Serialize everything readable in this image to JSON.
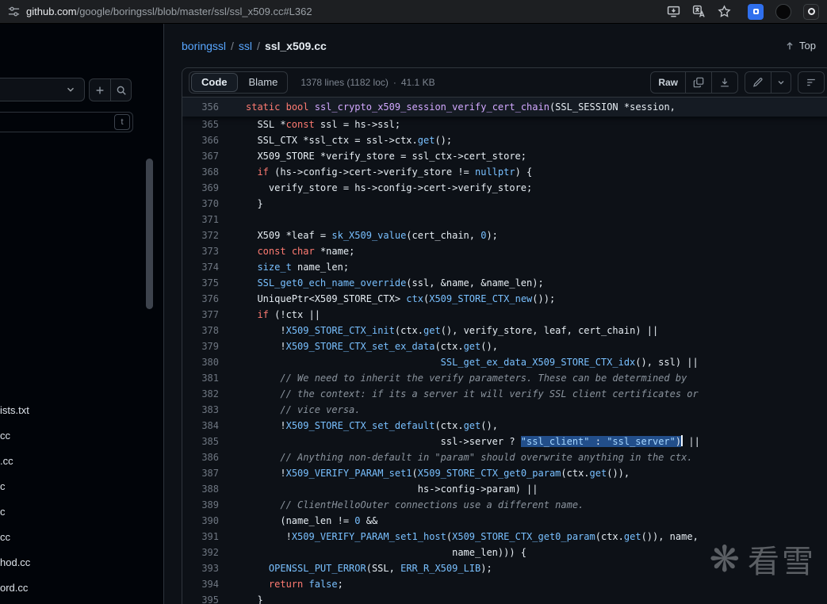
{
  "browser": {
    "url_domain": "github.com",
    "url_path": "/google/boringssl/blob/master/ssl/ssl_x509.cc#L362",
    "icons": [
      "tune-icon",
      "save-page-icon",
      "translate-icon",
      "bookmark-star-icon",
      "extension-icon",
      "profile-avatar",
      "apps-icon"
    ]
  },
  "breadcrumb": {
    "repo": "boringssl",
    "dir": "ssl",
    "file": "ssl_x509.cc",
    "separator": "/",
    "top_label": "Top"
  },
  "toolbar": {
    "code_tab": "Code",
    "blame_tab": "Blame",
    "lines_info": "1378 lines (1182 loc)",
    "dot": "·",
    "size_info": "41.1 KB",
    "raw_label": "Raw"
  },
  "sidebar": {
    "shortcut_hint": "t",
    "files": [
      "ists.txt",
      "cc",
      ".cc",
      "c",
      "c",
      "cc",
      "hod.cc",
      "ord.cc"
    ]
  },
  "watermark": {
    "logo": "❋",
    "text": "看雪"
  },
  "theme": {
    "background": "#0d1117",
    "sidebar_background": "#010409",
    "border": "#30363d",
    "link_blue": "#58a6ff",
    "keyword_red": "#ff7b72",
    "call_blue": "#79c0ff",
    "string_blue": "#a5d6ff",
    "function_purple": "#d2a8ff",
    "comment_gray": "#8b949e",
    "line_number_gray": "#6e7681",
    "selection_blue": "#1f6feb"
  },
  "code": {
    "lines": [
      {
        "n": "356",
        "sticky": true,
        "ind": 0,
        "segs": [
          {
            "t": "static",
            "c": "k"
          },
          {
            "t": " "
          },
          {
            "t": "bool",
            "c": "k"
          },
          {
            "t": " "
          },
          {
            "t": "ssl_crypto_x509_session_verify_cert_chain",
            "c": "fn"
          },
          {
            "t": "(SSL_SESSION *session,"
          }
        ]
      },
      {
        "n": "365",
        "ind": 2,
        "segs": [
          {
            "t": "SSL *"
          },
          {
            "t": "const",
            "c": "k"
          },
          {
            "t": " ssl = hs->ssl;"
          }
        ]
      },
      {
        "n": "366",
        "ind": 2,
        "segs": [
          {
            "t": "SSL_CTX *ssl_ctx = ssl->ctx."
          },
          {
            "t": "get",
            "c": "c"
          },
          {
            "t": "();"
          }
        ]
      },
      {
        "n": "367",
        "ind": 2,
        "segs": [
          {
            "t": "X509_STORE *verify_store = ssl_ctx->cert_store;"
          }
        ]
      },
      {
        "n": "368",
        "ind": 2,
        "segs": [
          {
            "t": "if",
            "c": "k"
          },
          {
            "t": " (hs->config->cert->verify_store != "
          },
          {
            "t": "nullptr",
            "c": "c"
          },
          {
            "t": ") {"
          }
        ]
      },
      {
        "n": "369",
        "ind": 4,
        "segs": [
          {
            "t": "verify_store = hs->config->cert->verify_store;"
          }
        ]
      },
      {
        "n": "370",
        "ind": 2,
        "segs": [
          {
            "t": "}"
          }
        ]
      },
      {
        "n": "371",
        "ind": 0,
        "segs": []
      },
      {
        "n": "372",
        "ind": 2,
        "segs": [
          {
            "t": "X509 *leaf = "
          },
          {
            "t": "sk_X509_value",
            "c": "c"
          },
          {
            "t": "(cert_chain, "
          },
          {
            "t": "0",
            "c": "c"
          },
          {
            "t": ");"
          }
        ]
      },
      {
        "n": "373",
        "ind": 2,
        "segs": [
          {
            "t": "const",
            "c": "k"
          },
          {
            "t": " "
          },
          {
            "t": "char",
            "c": "k"
          },
          {
            "t": " *name;"
          }
        ]
      },
      {
        "n": "374",
        "ind": 2,
        "segs": [
          {
            "t": "size_t",
            "c": "c"
          },
          {
            "t": " name_len;"
          }
        ]
      },
      {
        "n": "375",
        "ind": 2,
        "segs": [
          {
            "t": "SSL_get0_ech_name_override",
            "c": "c"
          },
          {
            "t": "(ssl, &name, &name_len);"
          }
        ]
      },
      {
        "n": "376",
        "ind": 2,
        "segs": [
          {
            "t": "UniquePtr<X509_STORE_CTX> "
          },
          {
            "t": "ctx",
            "c": "c"
          },
          {
            "t": "("
          },
          {
            "t": "X509_STORE_CTX_new",
            "c": "c"
          },
          {
            "t": "());"
          }
        ]
      },
      {
        "n": "377",
        "ind": 2,
        "segs": [
          {
            "t": "if",
            "c": "k"
          },
          {
            "t": " (!ctx ||"
          }
        ]
      },
      {
        "n": "378",
        "ind": 6,
        "segs": [
          {
            "t": "!"
          },
          {
            "t": "X509_STORE_CTX_init",
            "c": "c"
          },
          {
            "t": "(ctx."
          },
          {
            "t": "get",
            "c": "c"
          },
          {
            "t": "(), verify_store, leaf, cert_chain) ||"
          }
        ]
      },
      {
        "n": "379",
        "ind": 6,
        "segs": [
          {
            "t": "!"
          },
          {
            "t": "X509_STORE_CTX_set_ex_data",
            "c": "c"
          },
          {
            "t": "(ctx."
          },
          {
            "t": "get",
            "c": "c"
          },
          {
            "t": "(),"
          }
        ]
      },
      {
        "n": "380",
        "ind": 34,
        "segs": [
          {
            "t": "SSL_get_ex_data_X509_STORE_CTX_idx",
            "c": "c"
          },
          {
            "t": "(), ssl) ||"
          }
        ]
      },
      {
        "n": "381",
        "ind": 6,
        "segs": [
          {
            "t": "// We need to inherit the verify parameters. These can be determined by",
            "c": "cm"
          }
        ]
      },
      {
        "n": "382",
        "ind": 6,
        "segs": [
          {
            "t": "// the context: if its a server it will verify SSL client certificates or",
            "c": "cm"
          }
        ]
      },
      {
        "n": "383",
        "ind": 6,
        "segs": [
          {
            "t": "// vice versa.",
            "c": "cm"
          }
        ]
      },
      {
        "n": "384",
        "ind": 6,
        "segs": [
          {
            "t": "!"
          },
          {
            "t": "X509_STORE_CTX_set_default",
            "c": "c"
          },
          {
            "t": "(ctx."
          },
          {
            "t": "get",
            "c": "c"
          },
          {
            "t": "(),"
          }
        ]
      },
      {
        "n": "385",
        "ind": 34,
        "segs": [
          {
            "t": "ssl->server ? "
          },
          {
            "t": "\"ssl_client\"",
            "c": "s",
            "sel": true
          },
          {
            "t": " : ",
            "sel": true
          },
          {
            "t": "\"ssl_server\"",
            "c": "s",
            "sel": true
          },
          {
            "t": ")",
            "sel": true,
            "caret": true
          },
          {
            "t": " ||"
          }
        ]
      },
      {
        "n": "386",
        "ind": 6,
        "segs": [
          {
            "t": "// Anything non-default in \"param\" should overwrite anything in the ctx.",
            "c": "cm"
          }
        ]
      },
      {
        "n": "387",
        "ind": 6,
        "segs": [
          {
            "t": "!"
          },
          {
            "t": "X509_VERIFY_PARAM_set1",
            "c": "c"
          },
          {
            "t": "("
          },
          {
            "t": "X509_STORE_CTX_get0_param",
            "c": "c"
          },
          {
            "t": "(ctx."
          },
          {
            "t": "get",
            "c": "c"
          },
          {
            "t": "()),"
          }
        ]
      },
      {
        "n": "388",
        "ind": 30,
        "segs": [
          {
            "t": "hs->config->param) ||"
          }
        ]
      },
      {
        "n": "389",
        "ind": 6,
        "segs": [
          {
            "t": "// ClientHelloOuter connections use a different name.",
            "c": "cm"
          }
        ]
      },
      {
        "n": "390",
        "ind": 6,
        "segs": [
          {
            "t": "(name_len != "
          },
          {
            "t": "0",
            "c": "c"
          },
          {
            "t": " &&"
          }
        ]
      },
      {
        "n": "391",
        "ind": 7,
        "segs": [
          {
            "t": "!"
          },
          {
            "t": "X509_VERIFY_PARAM_set1_host",
            "c": "c"
          },
          {
            "t": "("
          },
          {
            "t": "X509_STORE_CTX_get0_param",
            "c": "c"
          },
          {
            "t": "(ctx."
          },
          {
            "t": "get",
            "c": "c"
          },
          {
            "t": "()), name,"
          }
        ]
      },
      {
        "n": "392",
        "ind": 36,
        "segs": [
          {
            "t": "name_len))) {"
          }
        ]
      },
      {
        "n": "393",
        "ind": 4,
        "segs": [
          {
            "t": "OPENSSL_PUT_ERROR",
            "c": "c"
          },
          {
            "t": "(SSL, "
          },
          {
            "t": "ERR_R_X509_LIB",
            "c": "c"
          },
          {
            "t": ");"
          }
        ]
      },
      {
        "n": "394",
        "ind": 4,
        "segs": [
          {
            "t": "return",
            "c": "k"
          },
          {
            "t": " "
          },
          {
            "t": "false",
            "c": "c"
          },
          {
            "t": ";"
          }
        ]
      },
      {
        "n": "395",
        "ind": 2,
        "segs": [
          {
            "t": "}"
          }
        ]
      }
    ]
  }
}
